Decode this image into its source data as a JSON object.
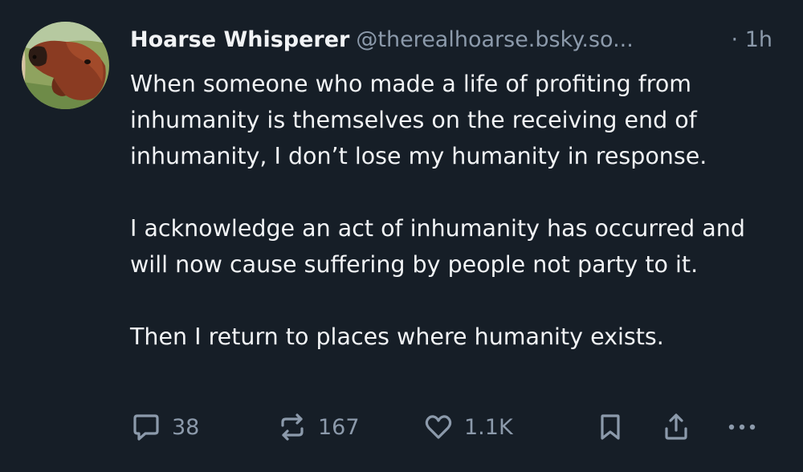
{
  "post": {
    "author": {
      "display_name": "Hoarse Whisperer",
      "handle": "@therealhoarse.bsky.so...",
      "avatar": "horse-avatar"
    },
    "timestamp": "· 1h",
    "paragraphs": [
      "When someone who made a life of profiting from inhumanity is themselves on the receiving end of inhumanity, I don’t lose my humanity in response.",
      "I acknowledge an act of inhumanity has occurred and will now cause suffering by people not party to it.",
      "Then I return to places where humanity exists."
    ],
    "actions": {
      "reply": {
        "icon": "reply-icon",
        "count": "38"
      },
      "repost": {
        "icon": "repost-icon",
        "count": "167"
      },
      "like": {
        "icon": "heart-icon",
        "count": "1.1K"
      },
      "bookmark": {
        "icon": "bookmark-icon"
      },
      "share": {
        "icon": "share-icon"
      },
      "more": {
        "icon": "more-icon"
      }
    }
  },
  "colors": {
    "background": "#161e27",
    "text": "#f1f3f5",
    "muted": "#8c9aab"
  }
}
